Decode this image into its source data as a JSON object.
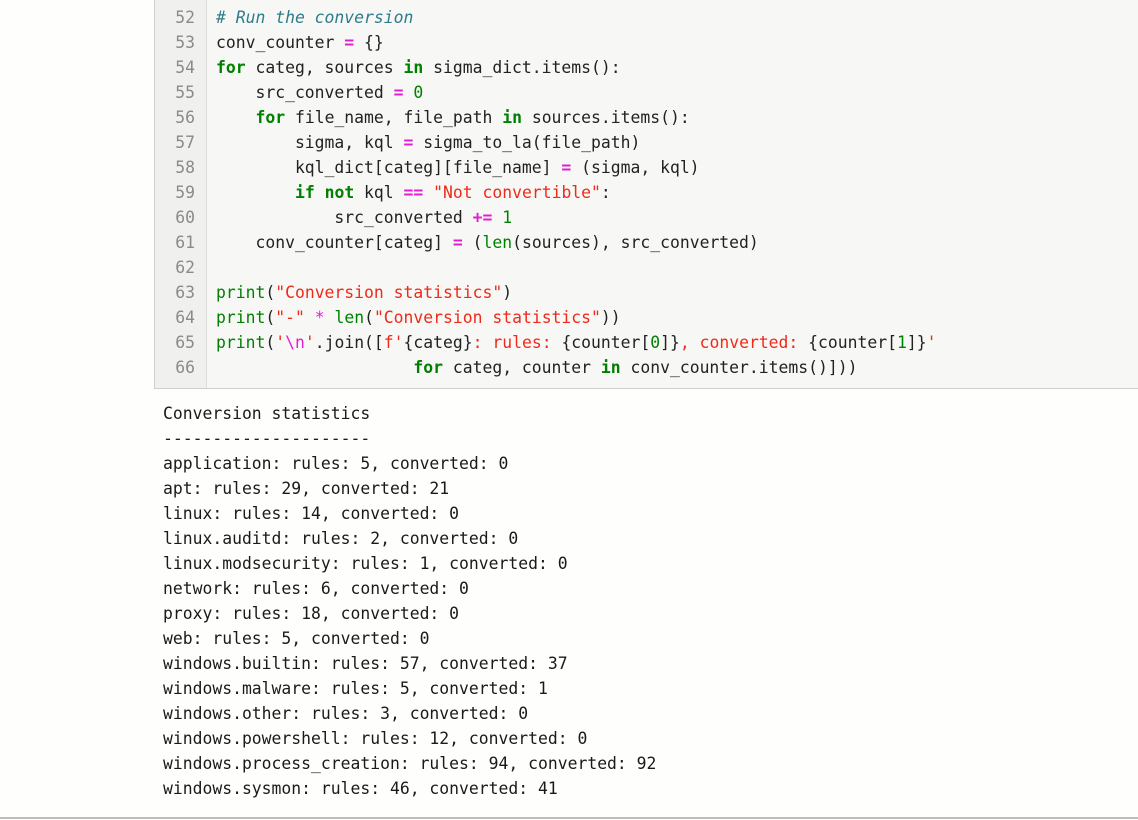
{
  "code_cell": {
    "lines": [
      {
        "number": "52",
        "tokens": [
          {
            "t": "c",
            "v": "# Run the conversion"
          }
        ]
      },
      {
        "number": "53",
        "tokens": [
          {
            "t": "p",
            "v": "conv_counter "
          },
          {
            "t": "o",
            "v": "="
          },
          {
            "t": "p",
            "v": " {}"
          }
        ]
      },
      {
        "number": "54",
        "tokens": [
          {
            "t": "k",
            "v": "for"
          },
          {
            "t": "p",
            "v": " categ, sources "
          },
          {
            "t": "k",
            "v": "in"
          },
          {
            "t": "p",
            "v": " sigma_dict.items():"
          }
        ]
      },
      {
        "number": "55",
        "tokens": [
          {
            "t": "p",
            "v": "    src_converted "
          },
          {
            "t": "o",
            "v": "="
          },
          {
            "t": "p",
            "v": " "
          },
          {
            "t": "n",
            "v": "0"
          }
        ]
      },
      {
        "number": "56",
        "tokens": [
          {
            "t": "p",
            "v": "    "
          },
          {
            "t": "k",
            "v": "for"
          },
          {
            "t": "p",
            "v": " file_name, file_path "
          },
          {
            "t": "k",
            "v": "in"
          },
          {
            "t": "p",
            "v": " sources.items():"
          }
        ]
      },
      {
        "number": "57",
        "tokens": [
          {
            "t": "p",
            "v": "        sigma, kql "
          },
          {
            "t": "o",
            "v": "="
          },
          {
            "t": "p",
            "v": " sigma_to_la(file_path)"
          }
        ]
      },
      {
        "number": "58",
        "tokens": [
          {
            "t": "p",
            "v": "        kql_dict[categ][file_name] "
          },
          {
            "t": "o",
            "v": "="
          },
          {
            "t": "p",
            "v": " (sigma, kql)"
          }
        ]
      },
      {
        "number": "59",
        "tokens": [
          {
            "t": "p",
            "v": "        "
          },
          {
            "t": "k",
            "v": "if"
          },
          {
            "t": "p",
            "v": " "
          },
          {
            "t": "k",
            "v": "not"
          },
          {
            "t": "p",
            "v": " kql "
          },
          {
            "t": "o",
            "v": "=="
          },
          {
            "t": "p",
            "v": " "
          },
          {
            "t": "s",
            "v": "\"Not convertible\""
          },
          {
            "t": "p",
            "v": ":"
          }
        ]
      },
      {
        "number": "60",
        "tokens": [
          {
            "t": "p",
            "v": "            src_converted "
          },
          {
            "t": "o",
            "v": "+="
          },
          {
            "t": "p",
            "v": " "
          },
          {
            "t": "n",
            "v": "1"
          }
        ]
      },
      {
        "number": "61",
        "tokens": [
          {
            "t": "p",
            "v": "    conv_counter[categ] "
          },
          {
            "t": "o",
            "v": "="
          },
          {
            "t": "p",
            "v": " ("
          },
          {
            "t": "b",
            "v": "len"
          },
          {
            "t": "p",
            "v": "(sources), src_converted)"
          }
        ]
      },
      {
        "number": "62",
        "tokens": []
      },
      {
        "number": "63",
        "tokens": [
          {
            "t": "b",
            "v": "print"
          },
          {
            "t": "p",
            "v": "("
          },
          {
            "t": "s",
            "v": "\"Conversion statistics\""
          },
          {
            "t": "p",
            "v": ")"
          }
        ]
      },
      {
        "number": "64",
        "tokens": [
          {
            "t": "b",
            "v": "print"
          },
          {
            "t": "p",
            "v": "("
          },
          {
            "t": "s",
            "v": "\"-\""
          },
          {
            "t": "p",
            "v": " "
          },
          {
            "t": "e",
            "v": "*"
          },
          {
            "t": "p",
            "v": " "
          },
          {
            "t": "b",
            "v": "len"
          },
          {
            "t": "p",
            "v": "("
          },
          {
            "t": "s",
            "v": "\"Conversion statistics\""
          },
          {
            "t": "p",
            "v": "))"
          }
        ]
      },
      {
        "number": "65",
        "tokens": [
          {
            "t": "b",
            "v": "print"
          },
          {
            "t": "p",
            "v": "("
          },
          {
            "t": "s",
            "v": "'"
          },
          {
            "t": "e",
            "v": "\\n"
          },
          {
            "t": "s",
            "v": "'"
          },
          {
            "t": "p",
            "v": ".join(["
          },
          {
            "t": "s",
            "v": "f'"
          },
          {
            "t": "p",
            "v": "{categ}"
          },
          {
            "t": "s",
            "v": ": rules: "
          },
          {
            "t": "p",
            "v": "{counter["
          },
          {
            "t": "n",
            "v": "0"
          },
          {
            "t": "p",
            "v": "]}"
          },
          {
            "t": "s",
            "v": ", converted: "
          },
          {
            "t": "p",
            "v": "{counter["
          },
          {
            "t": "n",
            "v": "1"
          },
          {
            "t": "p",
            "v": "]}"
          },
          {
            "t": "s",
            "v": "'"
          }
        ]
      },
      {
        "number": "66",
        "tokens": [
          {
            "t": "p",
            "v": "                    "
          },
          {
            "t": "k",
            "v": "for"
          },
          {
            "t": "p",
            "v": " categ, counter "
          },
          {
            "t": "k",
            "v": "in"
          },
          {
            "t": "p",
            "v": " conv_counter.items()]))"
          }
        ]
      }
    ]
  },
  "output": {
    "title": "Conversion statistics",
    "separator": "---------------------",
    "rows": [
      {
        "category": "application",
        "rules": 5,
        "converted": 0
      },
      {
        "category": "apt",
        "rules": 29,
        "converted": 21
      },
      {
        "category": "linux",
        "rules": 14,
        "converted": 0
      },
      {
        "category": "linux.auditd",
        "rules": 2,
        "converted": 0
      },
      {
        "category": "linux.modsecurity",
        "rules": 1,
        "converted": 0
      },
      {
        "category": "network",
        "rules": 6,
        "converted": 0
      },
      {
        "category": "proxy",
        "rules": 18,
        "converted": 0
      },
      {
        "category": "web",
        "rules": 5,
        "converted": 0
      },
      {
        "category": "windows.builtin",
        "rules": 57,
        "converted": 37
      },
      {
        "category": "windows.malware",
        "rules": 5,
        "converted": 1
      },
      {
        "category": "windows.other",
        "rules": 3,
        "converted": 0
      },
      {
        "category": "windows.powershell",
        "rules": 12,
        "converted": 0
      },
      {
        "category": "windows.process_creation",
        "rules": 94,
        "converted": 92
      },
      {
        "category": "windows.sysmon",
        "rules": 46,
        "converted": 41
      }
    ],
    "row_format": {
      "rules_label": "rules",
      "converted_label": "converted"
    }
  }
}
